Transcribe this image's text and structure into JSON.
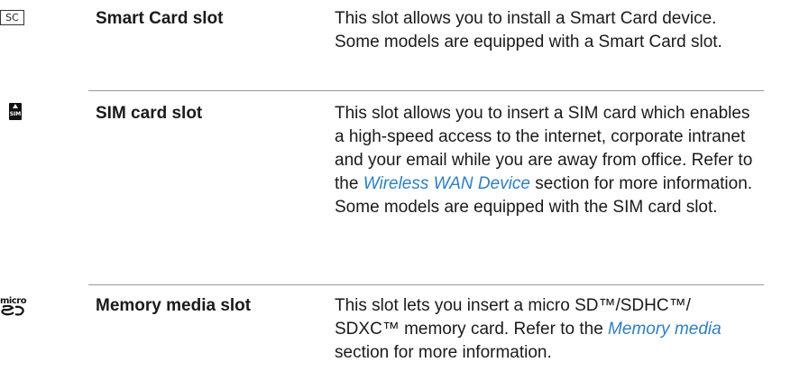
{
  "rows": [
    {
      "icon": "smart-card-icon",
      "icon_text": "SC",
      "name": "Smart Card slot",
      "desc_1": "This slot allows you to install a Smart Card device. Some models are equipped with a Smart Card slot."
    },
    {
      "icon": "sim-card-icon",
      "icon_text": "SIM",
      "name": "SIM card slot",
      "desc_1": "This slot allows you to insert a SIM card which enables a high-speed access to the internet, corporate intranet and your email while you are away from office. Refer to the ",
      "link": "Wireless WAN Device",
      "desc_2": " section for more information. Some models are equipped with the SIM card slot."
    },
    {
      "icon": "micro-sd-icon",
      "icon_text": "micro",
      "name": "Memory media slot",
      "desc_1": "This slot lets you insert a micro SD™/SDHC™/ SDXC™ memory card. Refer to the ",
      "link": "Memory media",
      "desc_2": " section for more information."
    }
  ],
  "colors": {
    "link": "#2f7fc0",
    "divider": "#999999",
    "text": "#1a1a1a"
  }
}
